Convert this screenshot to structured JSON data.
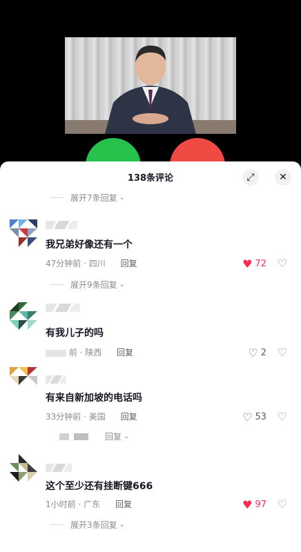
{
  "sheet": {
    "title": "138条评论"
  },
  "expanders": [
    {
      "label": "展开7条回复"
    },
    {
      "label": "展开9条回复"
    },
    {
      "label": "回复"
    },
    {
      "label": "展开3条回复"
    }
  ],
  "comments": [
    {
      "text": "我兄弟好像还有一个",
      "time": "47分钟前",
      "location": "四川",
      "reply": "回复",
      "likes": "72",
      "liked": true
    },
    {
      "text": "有我儿子的吗",
      "time": "前",
      "location": "陕西",
      "reply": "回复",
      "likes": "2",
      "liked": false
    },
    {
      "text": "有来自新加坡的电话吗",
      "time": "33分钟前",
      "location": "美国",
      "reply": "回复",
      "likes": "53",
      "liked": false
    },
    {
      "text": "这个至少还有挂断键666",
      "time": "1小时前",
      "location": "广东",
      "reply": "回复",
      "likes": "97",
      "liked": true
    }
  ],
  "colors": {
    "accept": "#27c24c",
    "decline": "#f04a45",
    "like_active": "#fe2c55"
  },
  "icons": {
    "expand": "expand-icon",
    "close": "close-icon",
    "heart": "heart-icon",
    "dislike": "broken-heart-icon"
  }
}
